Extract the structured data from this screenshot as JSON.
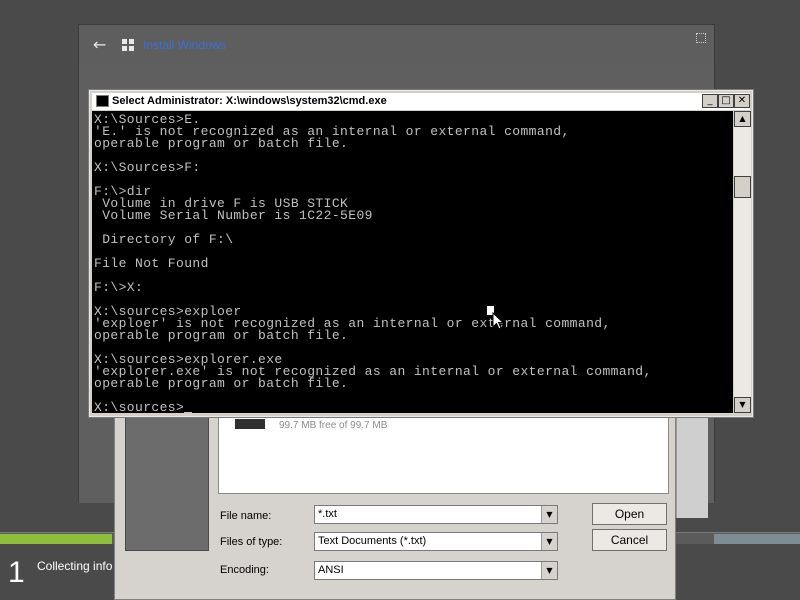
{
  "setup": {
    "title": "Install Windows",
    "progress_step": "1",
    "progress_label": "Collecting info"
  },
  "open_dialog": {
    "drive_free_space": "99.7 MB free of 99.7 MB",
    "file_name_label": "File name:",
    "file_name_value": "*.txt",
    "files_of_type_label": "Files of type:",
    "files_of_type_value": "Text Documents (*.txt)",
    "encoding_label": "Encoding:",
    "encoding_value": "ANSI",
    "open_button": "Open",
    "cancel_button": "Cancel"
  },
  "cmd": {
    "title": "Select Administrator: X:\\windows\\system32\\cmd.exe",
    "lines": [
      "X:\\Sources>E.",
      "'E.' is not recognized as an internal or external command,",
      "operable program or batch file.",
      "",
      "X:\\Sources>F:",
      "",
      "F:\\>dir",
      " Volume in drive F is USB STICK",
      " Volume Serial Number is 1C22-5E09",
      "",
      " Directory of F:\\",
      "",
      "File Not Found",
      "",
      "F:\\>X:",
      "",
      "X:\\sources>exploer",
      "'exploer' is not recognized as an internal or external command,",
      "operable program or batch file.",
      "",
      "X:\\sources>explorer.exe",
      "'explorer.exe' is not recognized as an internal or external command,",
      "operable program or batch file.",
      "",
      "X:\\sources>"
    ]
  },
  "colors": {
    "console_background": "#000000",
    "console_text": "#c0c0c0",
    "setup_title": "#3a6fd8",
    "progress_done": "#8fbf3a"
  },
  "icons": {
    "back": "back-arrow-icon",
    "windows": "windows-logo-icon",
    "cmd": "cmd-icon",
    "pointer": "mouse-pointer-icon"
  }
}
